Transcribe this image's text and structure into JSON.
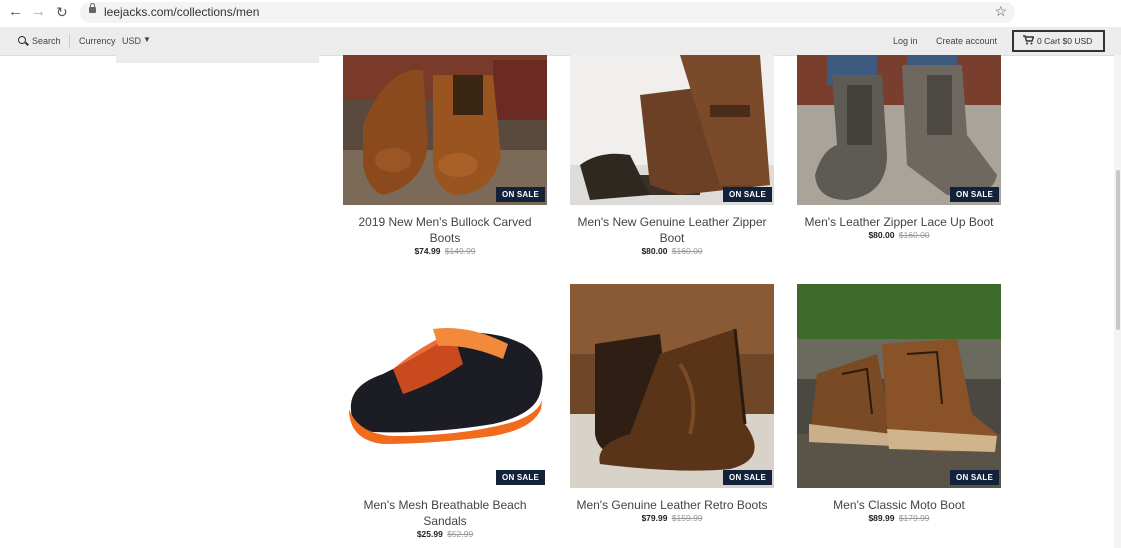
{
  "browser": {
    "url": "leejacks.com/collections/men"
  },
  "header": {
    "search_label": "Search",
    "currency_label": "Currency",
    "currency_value": "USD",
    "login_label": "Log in",
    "create_account_label": "Create account",
    "cart_label": "0 Cart $0 USD"
  },
  "products": [
    {
      "title": "2019 New Men's Bullock Carved Boots",
      "price": "$74.99",
      "original_price": "$149.99",
      "badge": "ON SALE"
    },
    {
      "title": "Men's New Genuine Leather Zipper Boot",
      "price": "$80.00",
      "original_price": "$160.00",
      "badge": "ON SALE"
    },
    {
      "title": "Men's Leather Zipper Lace Up Boot",
      "price": "$80.00",
      "original_price": "$160.00",
      "badge": "ON SALE"
    },
    {
      "title": "Men's Mesh Breathable Beach Sandals",
      "price": "$25.99",
      "original_price": "$52.99",
      "badge": "ON SALE"
    },
    {
      "title": "Men's Genuine Leather Retro Boots",
      "price": "$79.99",
      "original_price": "$159.99",
      "badge": "ON SALE"
    },
    {
      "title": "Men's Classic Moto Boot",
      "price": "$89.99",
      "original_price": "$179.99",
      "badge": "ON SALE"
    }
  ],
  "colors": {
    "badge_bg": "#13213a",
    "header_bg": "#ececec"
  }
}
